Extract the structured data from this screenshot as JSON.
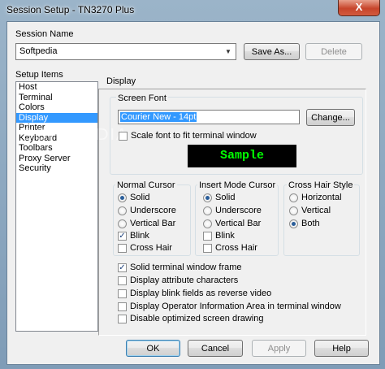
{
  "window": {
    "title": "Session Setup - TN3270 Plus",
    "close_label": "X"
  },
  "session_name": {
    "label": "Session Name",
    "value": "Softpedia",
    "save_as": "Save As...",
    "delete": "Delete"
  },
  "setup_items": {
    "label": "Setup Items",
    "items": [
      "Host",
      "Terminal",
      "Colors",
      "Display",
      "Printer",
      "Keyboard",
      "Toolbars",
      "Proxy Server",
      "Security"
    ],
    "selected": "Display"
  },
  "display": {
    "title": "Display",
    "screen_font": {
      "label": "Screen Font",
      "value": "Courier New - 14pt",
      "change": "Change...",
      "scale_label": "Scale font to fit terminal window",
      "scale_checked": false,
      "sample": "Sample"
    },
    "normal_cursor": {
      "label": "Normal Cursor",
      "solid": "Solid",
      "underscore": "Underscore",
      "vertical_bar": "Vertical Bar",
      "blink": "Blink",
      "cross_hair": "Cross Hair",
      "selected": "Solid",
      "blink_checked": true,
      "cross_hair_checked": false
    },
    "insert_cursor": {
      "label": "Insert Mode Cursor",
      "solid": "Solid",
      "underscore": "Underscore",
      "vertical_bar": "Vertical Bar",
      "blink": "Blink",
      "cross_hair": "Cross Hair",
      "selected": "Solid",
      "blink_checked": false,
      "cross_hair_checked": false
    },
    "cross_hair_style": {
      "label": "Cross Hair Style",
      "horizontal": "Horizontal",
      "vertical": "Vertical",
      "both": "Both",
      "selected": "Both"
    },
    "options": [
      {
        "label": "Solid terminal window frame",
        "checked": true
      },
      {
        "label": "Display attribute characters",
        "checked": false
      },
      {
        "label": "Display blink fields as reverse video",
        "checked": false
      },
      {
        "label": "Display Operator Information Area in terminal window",
        "checked": false
      },
      {
        "label": "Disable optimized screen drawing",
        "checked": false
      }
    ]
  },
  "buttons": {
    "ok": "OK",
    "cancel": "Cancel",
    "apply": "Apply",
    "help": "Help"
  },
  "watermark": "SOFTPEDIA"
}
